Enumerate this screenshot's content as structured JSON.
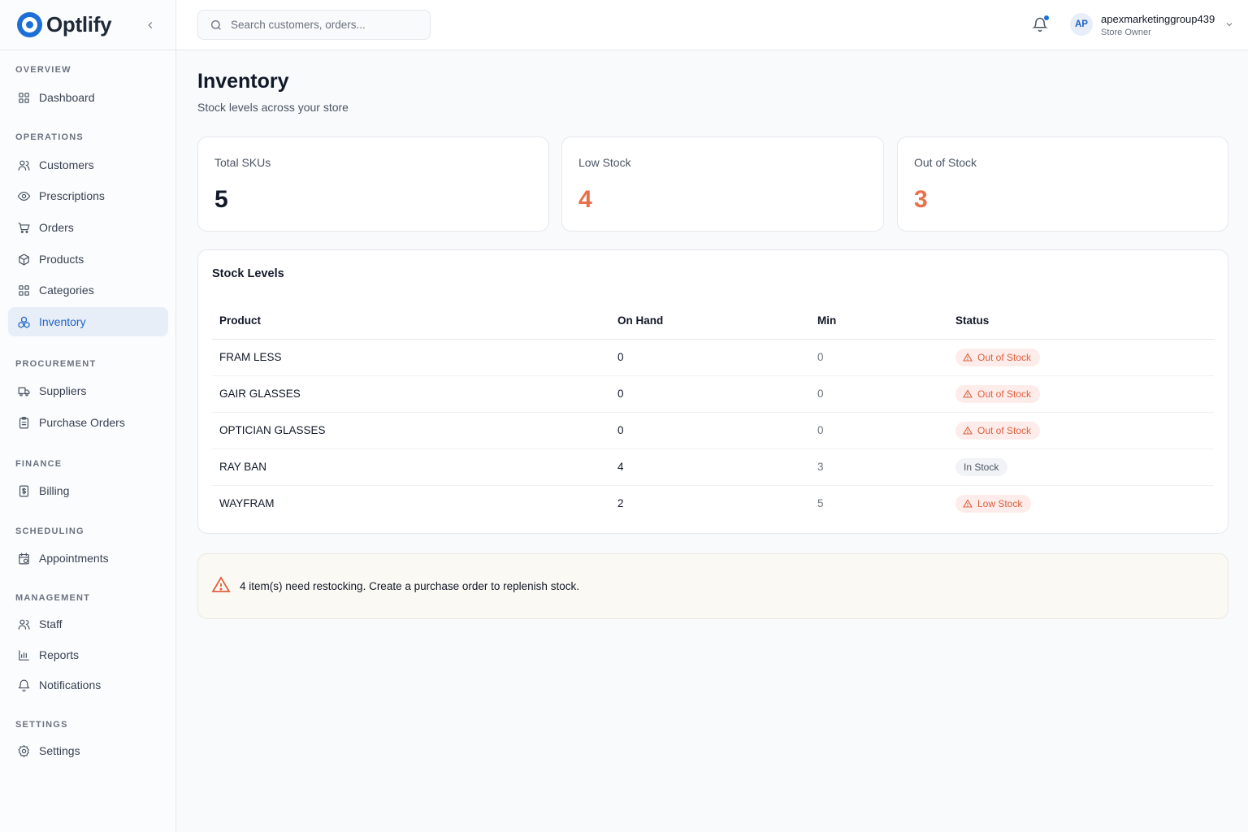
{
  "app": {
    "name": "Optlify"
  },
  "sidebar": {
    "sections": [
      {
        "title": "OVERVIEW",
        "items": [
          {
            "label": "Dashboard",
            "icon": "dashboard-icon"
          }
        ]
      },
      {
        "title": "OPERATIONS",
        "items": [
          {
            "label": "Customers",
            "icon": "users-icon"
          },
          {
            "label": "Prescriptions",
            "icon": "eye-icon"
          },
          {
            "label": "Orders",
            "icon": "cart-icon"
          },
          {
            "label": "Products",
            "icon": "package-icon"
          },
          {
            "label": "Categories",
            "icon": "grid-icon"
          },
          {
            "label": "Inventory",
            "icon": "inventory-icon",
            "active": true
          }
        ]
      },
      {
        "title": "PROCUREMENT",
        "items": [
          {
            "label": "Suppliers",
            "icon": "truck-icon"
          },
          {
            "label": "Purchase Orders",
            "icon": "clipboard-icon"
          }
        ]
      },
      {
        "title": "FINANCE",
        "items": [
          {
            "label": "Billing",
            "icon": "receipt-icon"
          }
        ]
      },
      {
        "title": "SCHEDULING",
        "items": [
          {
            "label": "Appointments",
            "icon": "calendar-icon"
          }
        ]
      },
      {
        "title": "MANAGEMENT",
        "items": [
          {
            "label": "Staff",
            "icon": "staff-icon"
          },
          {
            "label": "Reports",
            "icon": "bar-chart-icon"
          },
          {
            "label": "Notifications",
            "icon": "bell-icon"
          }
        ]
      },
      {
        "title": "SETTINGS",
        "items": [
          {
            "label": "Settings",
            "icon": "gear-icon"
          }
        ]
      }
    ]
  },
  "header": {
    "search_placeholder": "Search customers, orders...",
    "user": {
      "initials": "AP",
      "name": "apexmarketinggroup439",
      "role": "Store Owner"
    }
  },
  "page": {
    "title": "Inventory",
    "subtitle": "Stock levels across your store"
  },
  "stats": [
    {
      "label": "Total SKUs",
      "value": "5",
      "color": "#111827"
    },
    {
      "label": "Low Stock",
      "value": "4",
      "color": "#e8714a"
    },
    {
      "label": "Out of Stock",
      "value": "3",
      "color": "#e8714a"
    }
  ],
  "stock_table": {
    "title": "Stock Levels",
    "columns": [
      "Product",
      "On Hand",
      "Min",
      "Status"
    ],
    "rows": [
      {
        "product": "FRAM LESS",
        "on_hand": "0",
        "min": "0",
        "status": "Out of Stock",
        "warn": true
      },
      {
        "product": "GAIR GLASSES",
        "on_hand": "0",
        "min": "0",
        "status": "Out of Stock",
        "warn": true
      },
      {
        "product": "OPTICIAN GLASSES",
        "on_hand": "0",
        "min": "0",
        "status": "Out of Stock",
        "warn": true
      },
      {
        "product": "RAY BAN",
        "on_hand": "4",
        "min": "3",
        "status": "In Stock",
        "warn": false
      },
      {
        "product": "WAYFRAM",
        "on_hand": "2",
        "min": "5",
        "status": "Low Stock",
        "warn": true
      }
    ]
  },
  "alert": {
    "text": "4 item(s) need restocking. Create a purchase order to replenish stock.",
    "icon": "warning-icon"
  },
  "colors": {
    "accent": "#1d6fd8",
    "warning": "#e0603d"
  }
}
